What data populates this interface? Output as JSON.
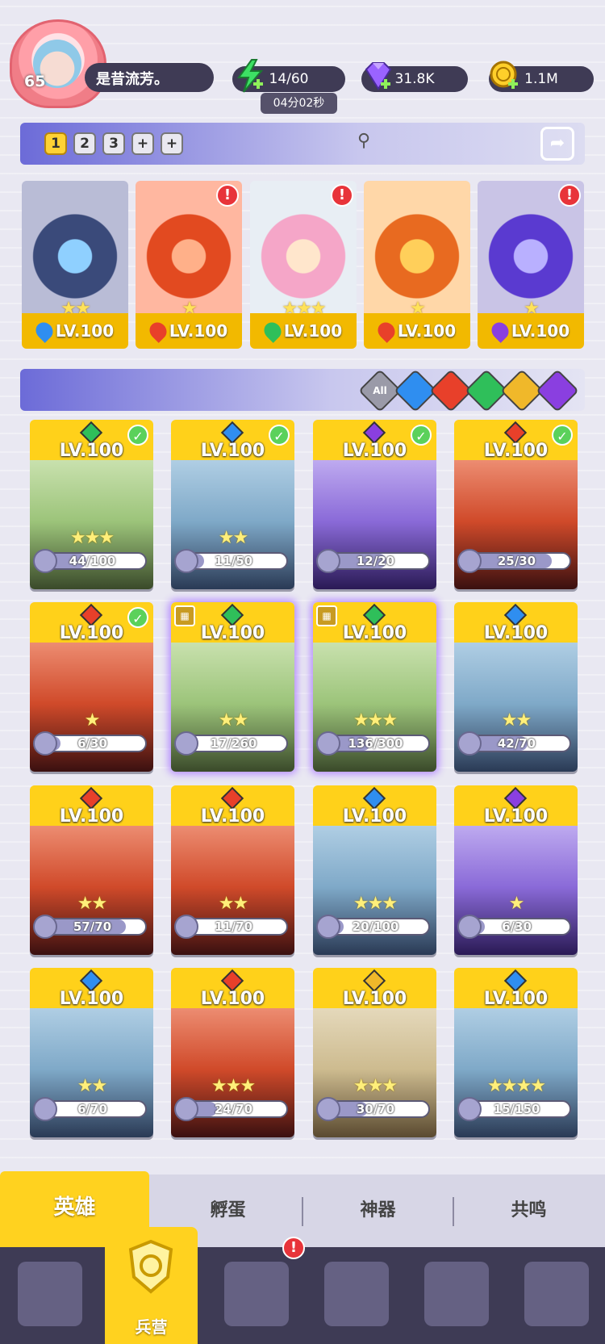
{
  "player": {
    "level": "65",
    "name": "是昔流芳。"
  },
  "resources": {
    "energy": "14/60",
    "energy_timer": "04分02秒",
    "gems": "31.8K",
    "coins": "1.1M"
  },
  "team_tabs": [
    "1",
    "2",
    "3",
    "+",
    "+"
  ],
  "team_slots": [
    {
      "level": "LV.100",
      "stars": "★★",
      "element": "water",
      "alert": false
    },
    {
      "level": "LV.100",
      "stars": "★",
      "element": "fire",
      "alert": true
    },
    {
      "level": "LV.100",
      "stars": "★★★",
      "element": "wind",
      "alert": true
    },
    {
      "level": "LV.100",
      "stars": "★",
      "element": "fire",
      "alert": false
    },
    {
      "level": "LV.100",
      "stars": "★",
      "element": "dark",
      "alert": true
    }
  ],
  "filters": {
    "all_label": "All",
    "elements": [
      "water",
      "fire",
      "wind",
      "light",
      "dark"
    ]
  },
  "heroes": [
    {
      "level": "LV.100",
      "stars": "★★★",
      "progress": "44/100",
      "element": "wind",
      "check": true,
      "rank": false
    },
    {
      "level": "LV.100",
      "stars": "★★",
      "progress": "11/50",
      "element": "water",
      "check": true,
      "rank": false
    },
    {
      "level": "LV.100",
      "stars": "",
      "progress": "12/20",
      "element": "dark",
      "check": true,
      "rank": false
    },
    {
      "level": "LV.100",
      "stars": "",
      "progress": "25/30",
      "element": "fire",
      "check": true,
      "rank": false
    },
    {
      "level": "LV.100",
      "stars": "★",
      "progress": "6/30",
      "element": "fire",
      "check": true,
      "rank": false
    },
    {
      "level": "LV.100",
      "stars": "★★",
      "progress": "17/260",
      "element": "wind",
      "check": false,
      "rank": true
    },
    {
      "level": "LV.100",
      "stars": "★★★",
      "progress": "136/300",
      "element": "wind",
      "check": false,
      "rank": true
    },
    {
      "level": "LV.100",
      "stars": "★★",
      "progress": "42/70",
      "element": "water",
      "check": false,
      "rank": false
    },
    {
      "level": "LV.100",
      "stars": "★★",
      "progress": "57/70",
      "element": "fire",
      "check": false,
      "rank": false
    },
    {
      "level": "LV.100",
      "stars": "★★",
      "progress": "11/70",
      "element": "fire",
      "check": false,
      "rank": false
    },
    {
      "level": "LV.100",
      "stars": "★★★",
      "progress": "20/100",
      "element": "water",
      "check": false,
      "rank": false
    },
    {
      "level": "LV.100",
      "stars": "★",
      "progress": "6/30",
      "element": "dark",
      "check": false,
      "rank": false
    },
    {
      "level": "LV.100",
      "stars": "★★",
      "progress": "6/70",
      "element": "water",
      "check": false,
      "rank": false
    },
    {
      "level": "LV.100",
      "stars": "★★★",
      "progress": "24/70",
      "element": "fire",
      "check": false,
      "rank": false
    },
    {
      "level": "LV.100",
      "stars": "★★★",
      "progress": "30/70",
      "element": "light",
      "check": false,
      "rank": false
    },
    {
      "level": "LV.100",
      "stars": "★★★★",
      "progress": "15/150",
      "element": "water",
      "check": false,
      "rank": false
    }
  ],
  "subtabs": [
    "英雄",
    "孵蛋",
    "神器",
    "共鸣"
  ],
  "nav": {
    "active_label": "兵营"
  },
  "colors": {
    "water": "#2f8ef0",
    "fire": "#e8402a",
    "wind": "#2fbf5a",
    "light": "#f0b82a",
    "dark": "#8a3fe0",
    "card_gold": "#ffd11a"
  }
}
